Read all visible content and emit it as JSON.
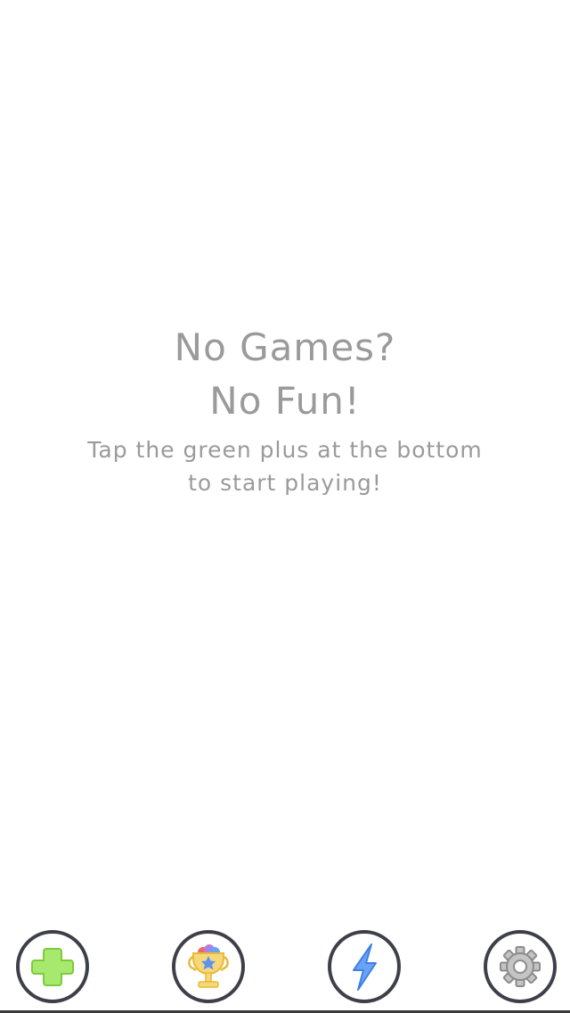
{
  "empty_state": {
    "title_line1": "No Games?",
    "title_line2": "No Fun!",
    "subtitle_line1": "Tap the green plus at the bottom",
    "subtitle_line2": "to start playing!"
  },
  "tabbar": {
    "items": [
      {
        "icon": "plus-icon",
        "color": "#8fdc4f"
      },
      {
        "icon": "trophy-icon",
        "color": "#f5cd5f"
      },
      {
        "icon": "lightning-icon",
        "color": "#5a93f2"
      },
      {
        "icon": "gear-icon",
        "color": "#a7a7a7"
      }
    ]
  },
  "colors": {
    "text": "#9a9a9a",
    "button_ring": "#3e4049",
    "background": "#ffffff"
  }
}
